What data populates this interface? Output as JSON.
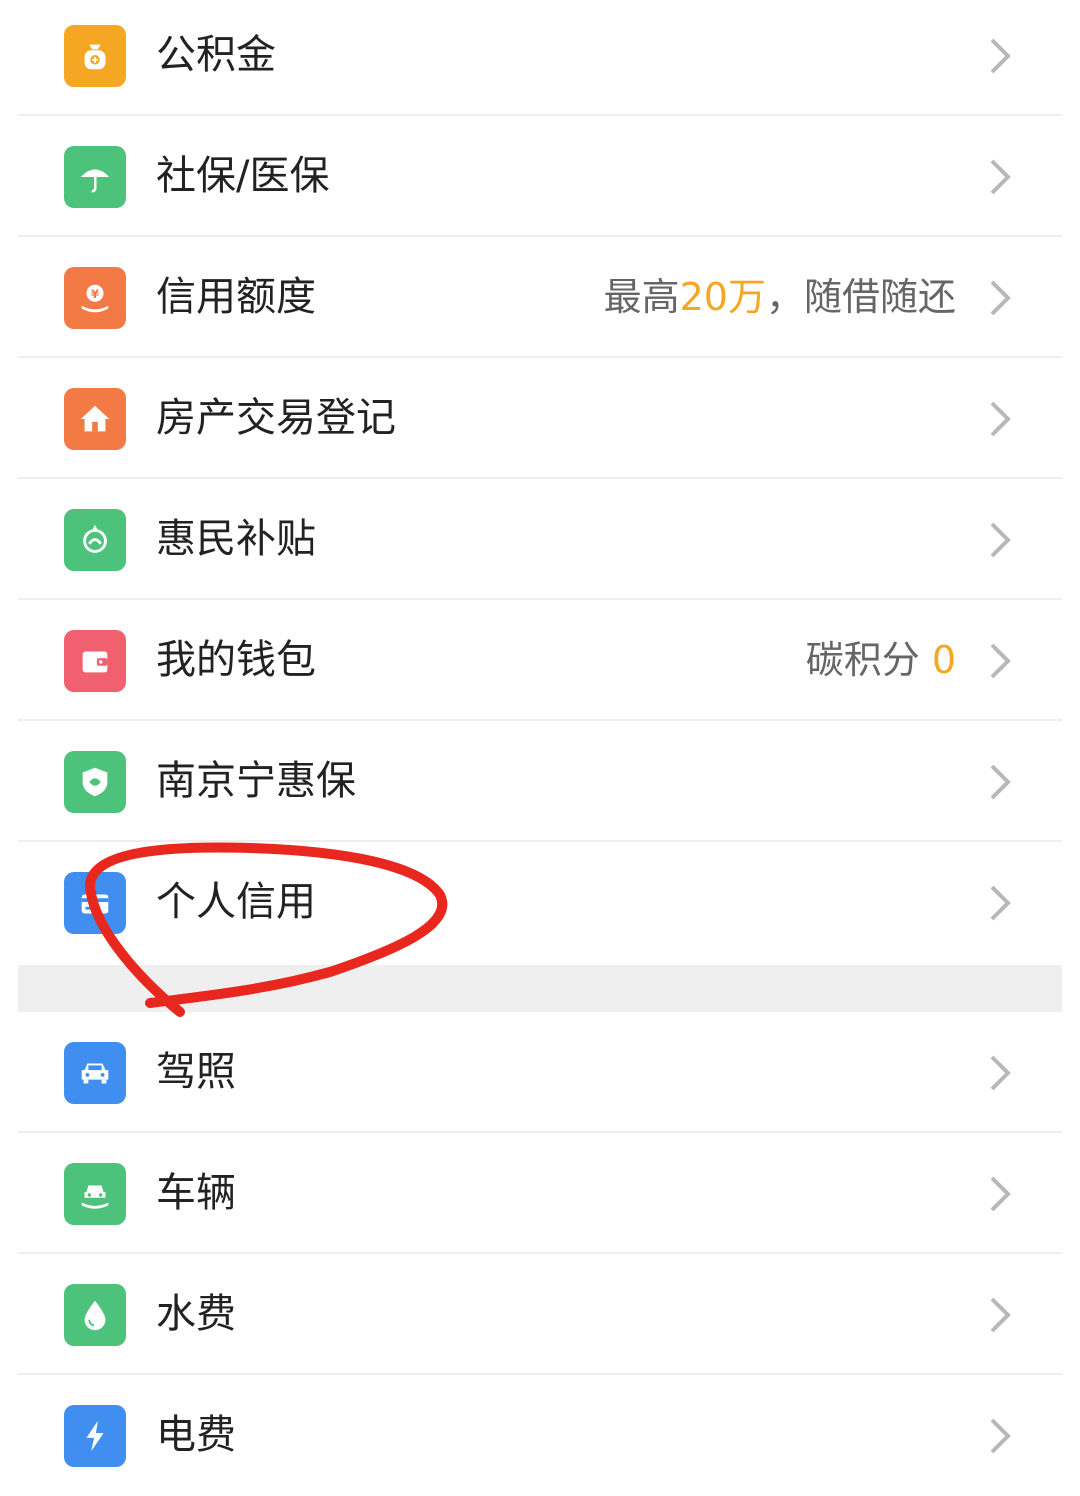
{
  "colors": {
    "orange": "#f5a623",
    "green": "#4cc27a",
    "coral": "#f47a45",
    "pink": "#f0606f",
    "blue": "#3f8ef0",
    "annotation_red": "#e8281f"
  },
  "items": [
    {
      "label": "公积金",
      "icon": "money-bag-icon",
      "icon_color": "#f5a623"
    },
    {
      "label": "社保/医保",
      "icon": "umbrella-icon",
      "icon_color": "#4cc27a"
    },
    {
      "label": "信用额度",
      "icon": "yuan-hand-icon",
      "icon_color": "#f47a45",
      "extra_prefix": "最高",
      "extra_highlight": "20万",
      "extra_suffix": "，随借随还"
    },
    {
      "label": "房产交易登记",
      "icon": "house-icon",
      "icon_color": "#f47a45"
    },
    {
      "label": "惠民补贴",
      "icon": "subsidy-icon",
      "icon_color": "#4cc27a"
    },
    {
      "label": "我的钱包",
      "icon": "wallet-icon",
      "icon_color": "#f0606f",
      "extra_prefix": "碳积分 ",
      "extra_highlight": "0"
    },
    {
      "label": "南京宁惠保",
      "icon": "shield-icon",
      "icon_color": "#4cc27a"
    },
    {
      "label": "个人信用",
      "icon": "credit-card-icon",
      "icon_color": "#3f8ef0"
    },
    {
      "label": "驾照",
      "icon": "car-icon",
      "icon_color": "#3f8ef0"
    },
    {
      "label": "车辆",
      "icon": "vehicle-icon",
      "icon_color": "#4cc27a"
    },
    {
      "label": "水费",
      "icon": "water-drop-icon",
      "icon_color": "#4cc27a"
    },
    {
      "label": "电费",
      "icon": "lightning-icon",
      "icon_color": "#3f8ef0"
    }
  ]
}
